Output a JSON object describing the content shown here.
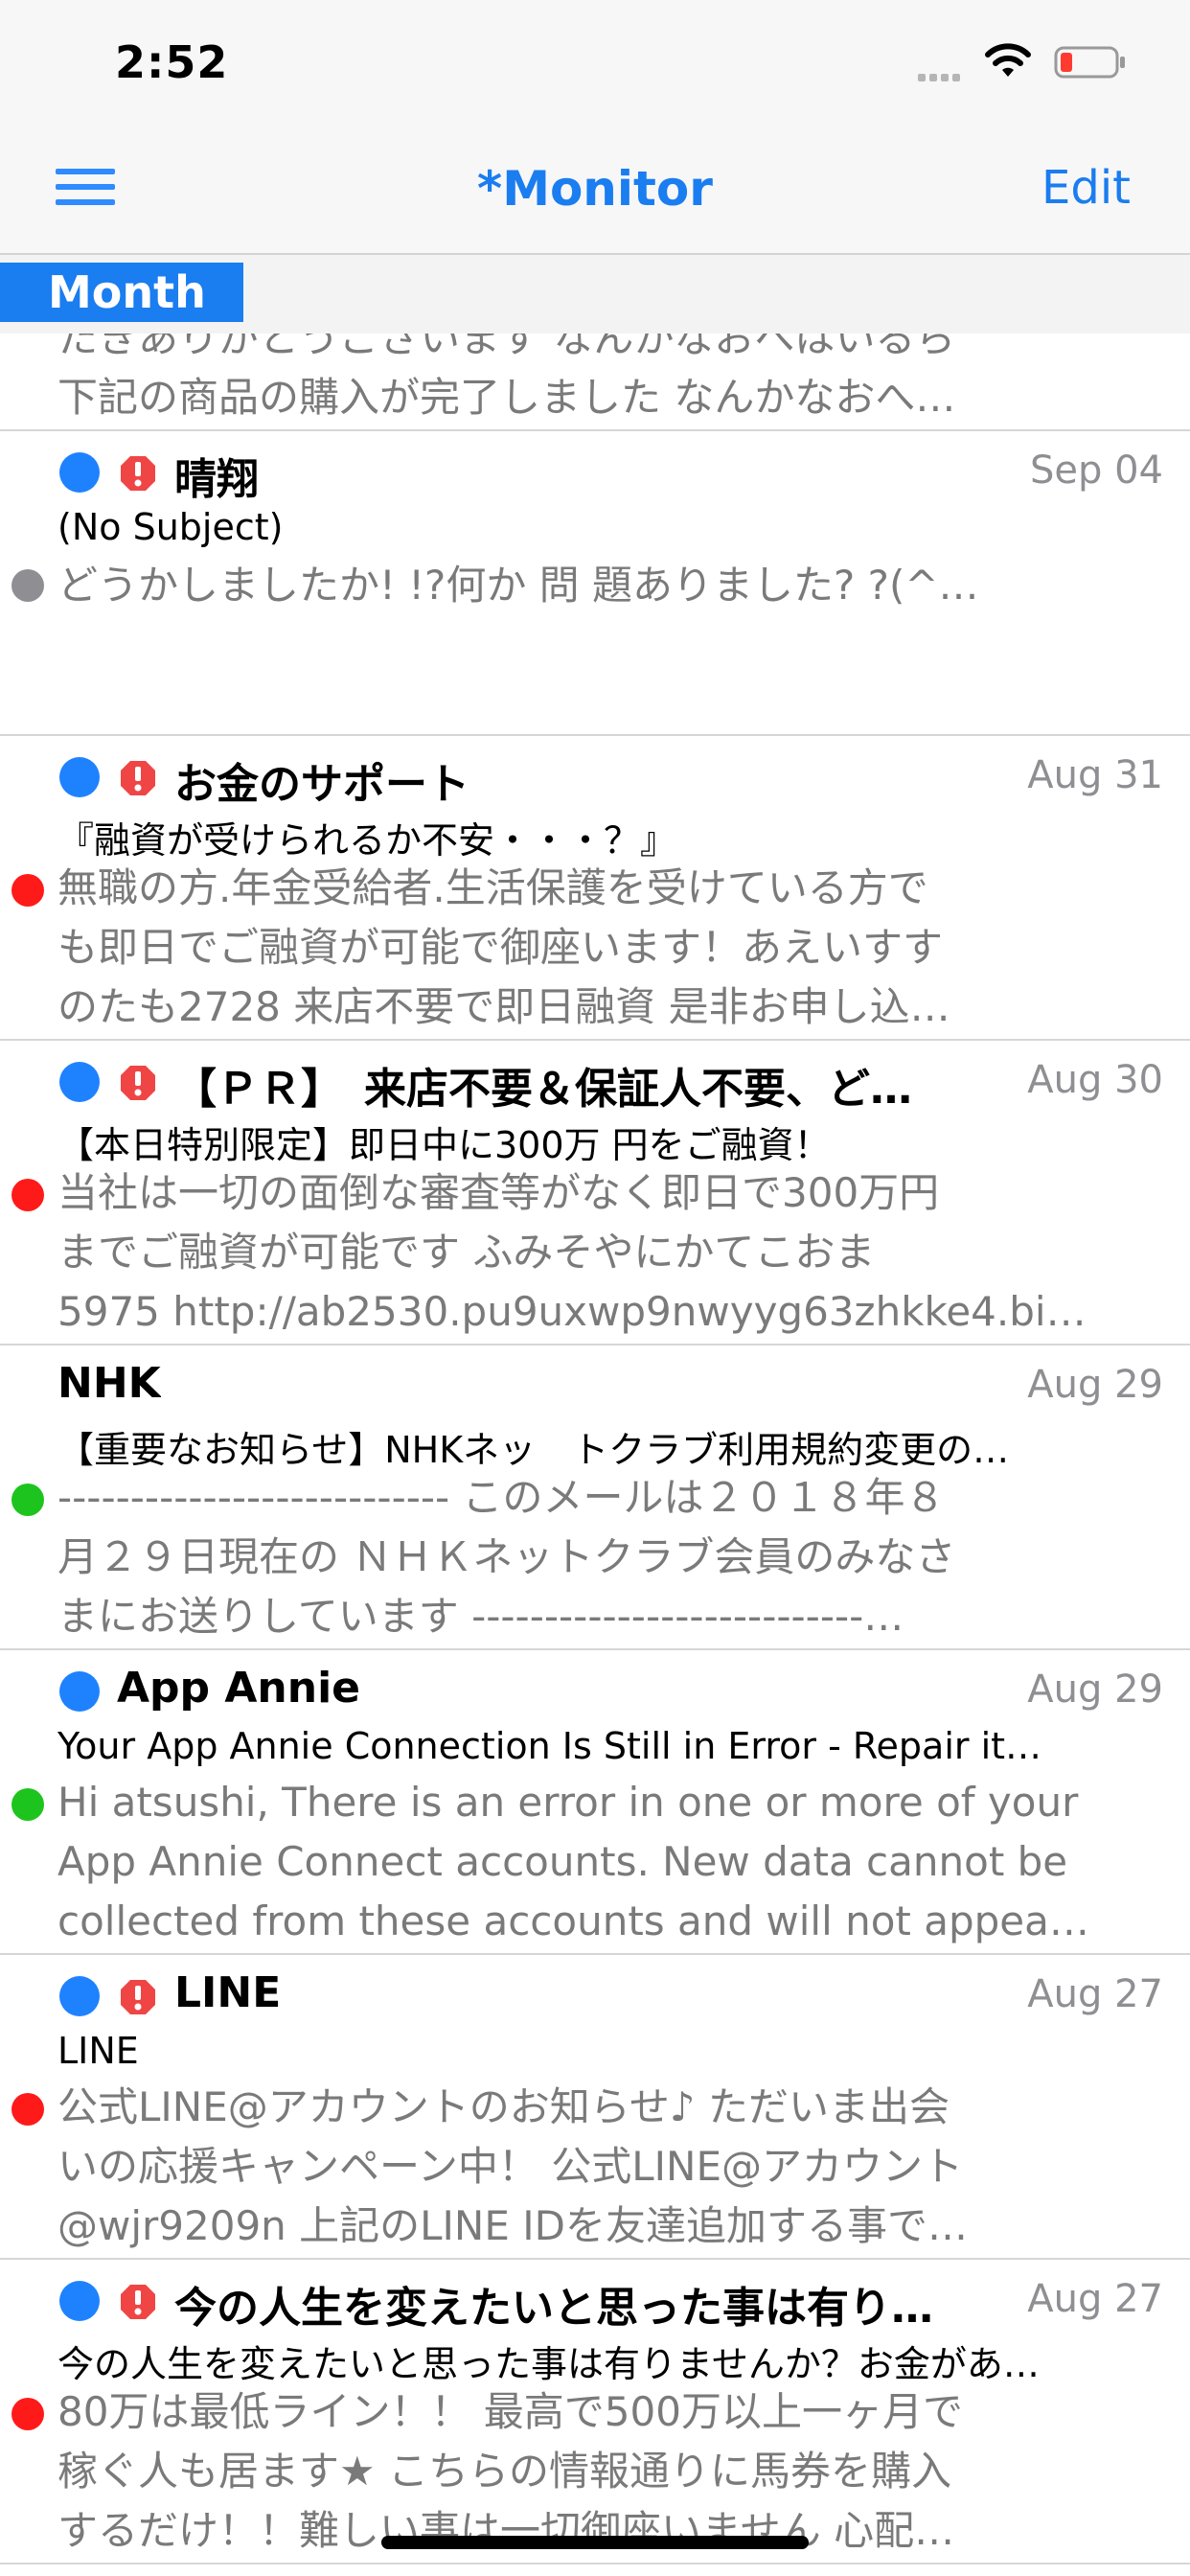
{
  "status_bar": {
    "time": "2:52"
  },
  "nav": {
    "title": "*Monitor",
    "edit_label": "Edit"
  },
  "section": {
    "label": "Month"
  },
  "partial_row": {
    "preview": [
      "たきありがとうございます なんかなおへはいるら",
      "下記の商品の購入が完了しました なんかなおへ…"
    ]
  },
  "messages": [
    {
      "sender": "晴翔",
      "date": "Sep 04",
      "subject": "(No Subject)",
      "preview": [
        "どうかしましたか! !?何か 問 題ありました? ?(^…"
      ],
      "unread": true,
      "flagged": true,
      "tag_color": "#8e8e93"
    },
    {
      "sender": "お金のサポート",
      "date": "Aug 31",
      "subject": "『融資が受けられるか不安・・・？』",
      "preview": [
        "無職の方.年金受給者.生活保護を受けている方で",
        "も即日でご融資が可能で御座います！あえいすす",
        "のたも2728 来店不要で即日融資 是非お申し込…"
      ],
      "unread": true,
      "flagged": true,
      "tag_color": "#ff1a1a"
    },
    {
      "sender": "【ＰＲ】　来店不要＆保証人不要、ど…",
      "date": "Aug 30",
      "subject": "【本日特別限定】即日中に300万 円をご融資！",
      "preview": [
        "当社は一切の面倒な審査等がなく即日で300万円",
        "までご融資が可能です ふみそやにかてこおま",
        "5975 http://ab2530.pu9uxwp9nwyyg63zhkke4.bi…"
      ],
      "unread": true,
      "flagged": true,
      "tag_color": "#ff1a1a"
    },
    {
      "sender": "NHK",
      "date": "Aug 29",
      "subject": "【重要なお知らせ】NHKネッ　トクラブ利用規約変更の…",
      "preview": [
        "--------------------------- このメールは２０１８年８",
        "月２９日現在の ＮＨＫネットクラブ会員のみなさ",
        "まにお送りしています ---------------------------…"
      ],
      "unread": false,
      "flagged": false,
      "tag_color": "#1ec41e"
    },
    {
      "sender": "App Annie",
      "date": "Aug 29",
      "subject": "Your App Annie Connection Is Still in Error - Repair it…",
      "preview": [
        "Hi atsushi, There is an error in one or more of your",
        "App Annie Connect accounts. New data cannot be",
        "collected from these accounts and will not appea…"
      ],
      "unread": true,
      "flagged": false,
      "tag_color": "#1ec41e"
    },
    {
      "sender": "LINE",
      "date": "Aug 27",
      "subject": "LINE",
      "preview": [
        "公式LINE@アカウントのお知らせ♪ ただいま出会",
        "いの応援キャンペーン中！ 公式LINE@アカウント",
        "@wjr9209n 上記のLINE IDを友達追加する事で…"
      ],
      "unread": true,
      "flagged": true,
      "tag_color": "#ff1a1a"
    },
    {
      "sender": "今の人生を変えたいと思った事は有り…",
      "date": "Aug 27",
      "subject": "今の人生を変えたいと思った事は有りませんか？お金があ…",
      "preview": [
        "80万は最低ライン！！ 最高で500万以上一ヶ月で",
        "稼ぐ人も居ます★ こちらの情報通りに馬券を購入",
        "するだけ！！難しい事は一切御座いません 心配…"
      ],
      "unread": true,
      "flagged": true,
      "tag_color": "#ff1a1a"
    }
  ]
}
